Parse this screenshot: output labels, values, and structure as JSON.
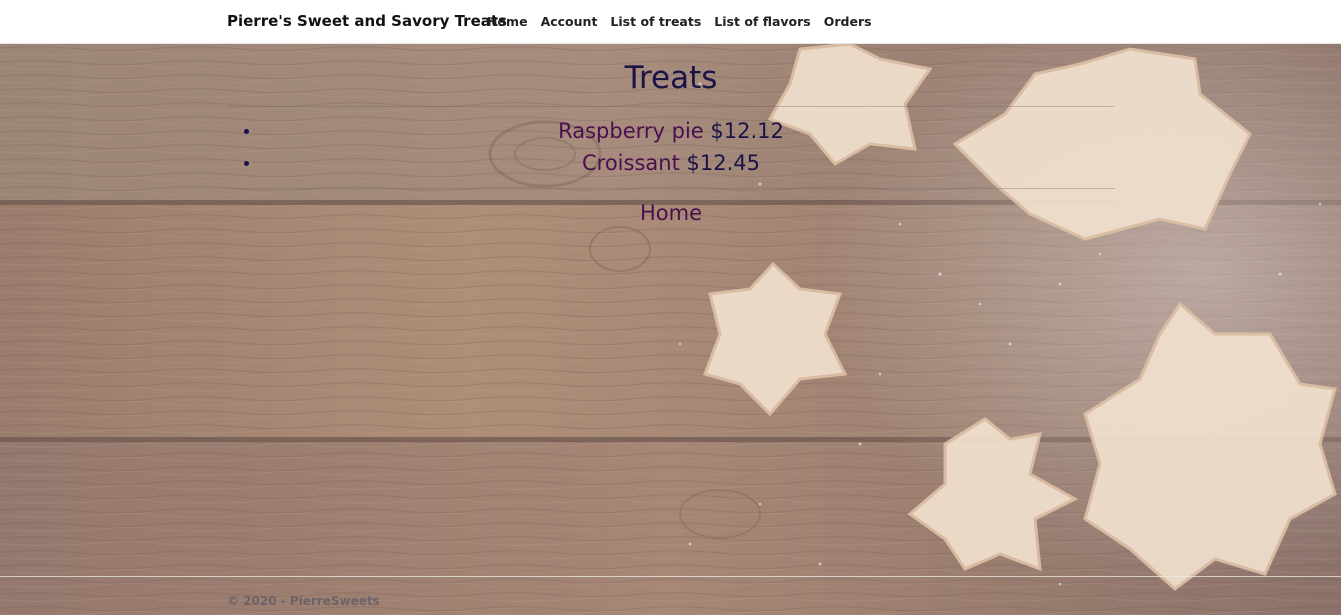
{
  "navbar": {
    "brand": "Pierre's Sweet and Savory Treats",
    "links": [
      "Home",
      "Account",
      "List of treats",
      "List of flavors",
      "Orders"
    ]
  },
  "main": {
    "title": "Treats",
    "treats": [
      {
        "name": "Raspberry pie",
        "price": "$12.12"
      },
      {
        "name": "Croissant",
        "price": "$12.45"
      }
    ],
    "home_link": "Home"
  },
  "footer": {
    "text": "© 2020 - PierreSweets"
  },
  "background": {
    "description_icon": "wood-cookies-background",
    "wood_color": "#8a6a59",
    "cookie_color": "#f0ddc8"
  }
}
